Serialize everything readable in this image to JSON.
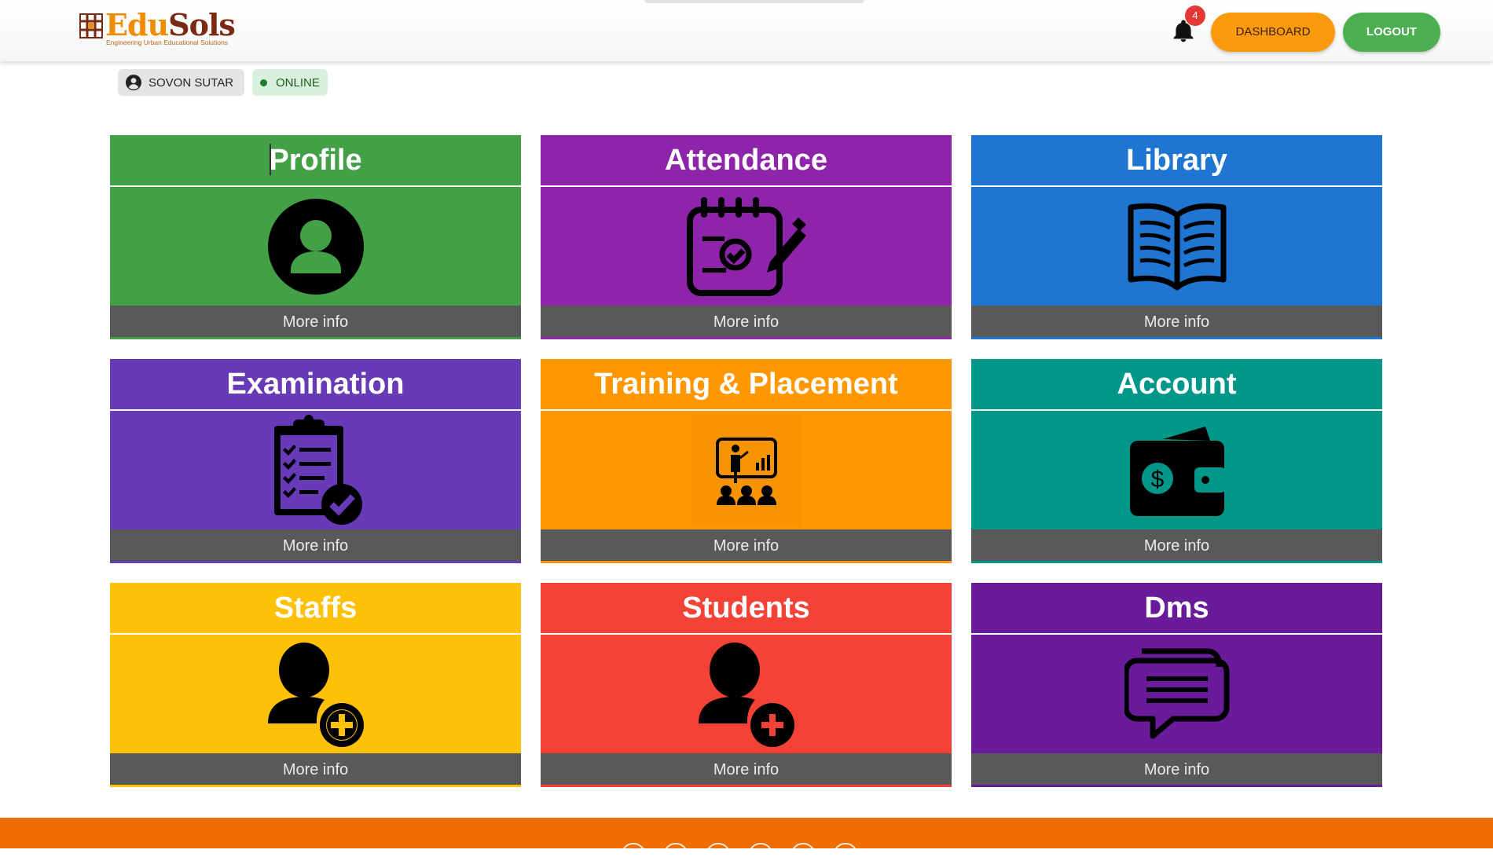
{
  "brand": {
    "name_part1": "Edu",
    "name_part2": "Sols",
    "tagline": "Engineering Urban Educational Solutions"
  },
  "header": {
    "notification_count": "4",
    "dashboard_label": "DASHBOARD",
    "logout_label": "LOGOUT"
  },
  "user": {
    "name": "SOVON SUTAR",
    "status": "ONLINE"
  },
  "colors": {
    "profile": "#43a047",
    "attendance": "#8e24aa",
    "library": "#1e76d2",
    "examination": "#673ab7",
    "training": "#ff9800",
    "account": "#009688",
    "staffs": "#ffc107",
    "students": "#f44336",
    "dms": "#6a1b9a",
    "footer": "#ef6c00"
  },
  "cards": [
    {
      "title": "Profile",
      "icon": "user-circle-icon",
      "more": "More info"
    },
    {
      "title": "Attendance",
      "icon": "calendar-check-edit-icon",
      "more": "More info"
    },
    {
      "title": "Library",
      "icon": "open-book-icon",
      "more": "More info"
    },
    {
      "title": "Examination",
      "icon": "clipboard-check-icon",
      "more": "More info"
    },
    {
      "title": "Training & Placement",
      "icon": "presentation-training-icon",
      "more": "More info"
    },
    {
      "title": "Account",
      "icon": "wallet-icon",
      "more": "More info"
    },
    {
      "title": "Staffs",
      "icon": "user-add-icon",
      "more": "More info"
    },
    {
      "title": "Students",
      "icon": "user-add-icon",
      "more": "More info"
    },
    {
      "title": "Dms",
      "icon": "chat-bubbles-icon",
      "more": "More info"
    }
  ]
}
